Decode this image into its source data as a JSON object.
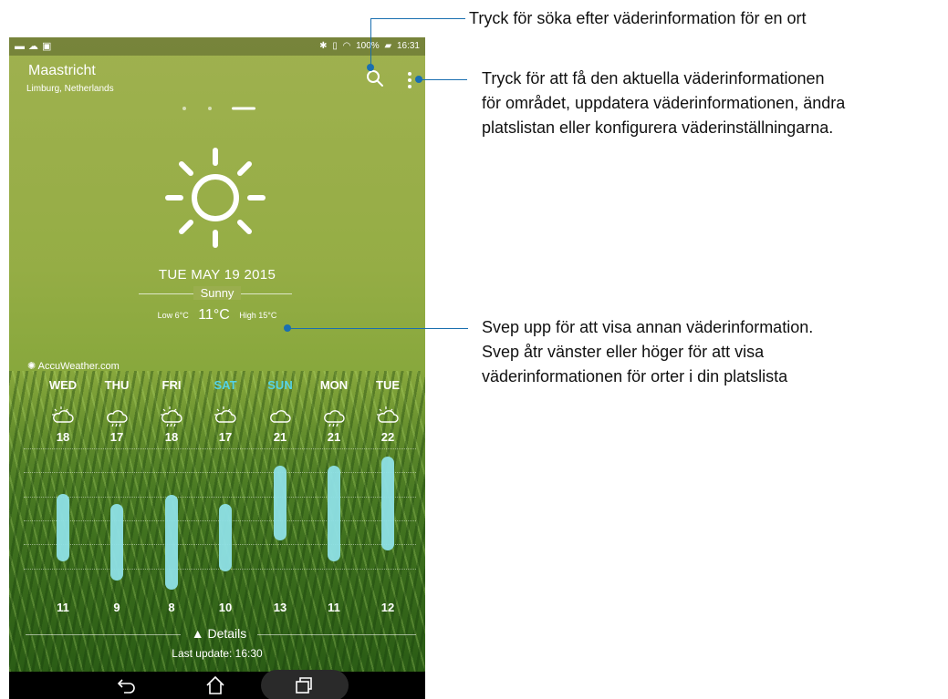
{
  "statusbar": {
    "left_icons": [
      "picture-icon",
      "cloud-upload-icon",
      "briefcase-icon"
    ],
    "battery": "100%",
    "time": "16:31"
  },
  "location": {
    "city": "Maastricht",
    "region": "Limburg, Netherlands"
  },
  "current": {
    "date": "TUE MAY 19 2015",
    "condition": "Sunny",
    "low_label": "Low 6°C",
    "temp": "11°C",
    "high_label": "High 15°C",
    "icon": "sun-icon"
  },
  "provider": "AccuWeather.com",
  "accent": "#55d3e8",
  "bar_color": "#8ee0e6",
  "forecast": [
    {
      "day": "WED",
      "high": "18",
      "low": "11",
      "weekend": false,
      "icon": "partly-cloudy-icon"
    },
    {
      "day": "THU",
      "high": "17",
      "low": "9",
      "weekend": false,
      "icon": "rain-icon"
    },
    {
      "day": "FRI",
      "high": "18",
      "low": "8",
      "weekend": false,
      "icon": "sun-cloud-rain-icon"
    },
    {
      "day": "SAT",
      "high": "17",
      "low": "10",
      "weekend": true,
      "icon": "partly-cloudy-icon"
    },
    {
      "day": "SUN",
      "high": "21",
      "low": "13",
      "weekend": true,
      "icon": "cloud-icon"
    },
    {
      "day": "MON",
      "high": "21",
      "low": "11",
      "weekend": false,
      "icon": "rain-icon"
    },
    {
      "day": "TUE",
      "high": "22",
      "low": "12",
      "weekend": false,
      "icon": "partly-cloudy-icon"
    }
  ],
  "footer": {
    "details": "Details",
    "last_update": "Last update: 16:30"
  },
  "callouts": {
    "search": "Tryck för söka efter väderinformation för en ort",
    "menu_line1": "Tryck för att få den aktuella väderinformationen",
    "menu_line2": "för området, uppdatera väderinformationen, ändra",
    "menu_line3": "platslistan eller konfigurera väderinställningarna.",
    "swipe_line1": "Svep upp för att visa annan väderinformation.",
    "swipe_line2": "Svep åtr vänster eller höger för att visa",
    "swipe_line3": "väderinformationen för orter i din platslista"
  }
}
